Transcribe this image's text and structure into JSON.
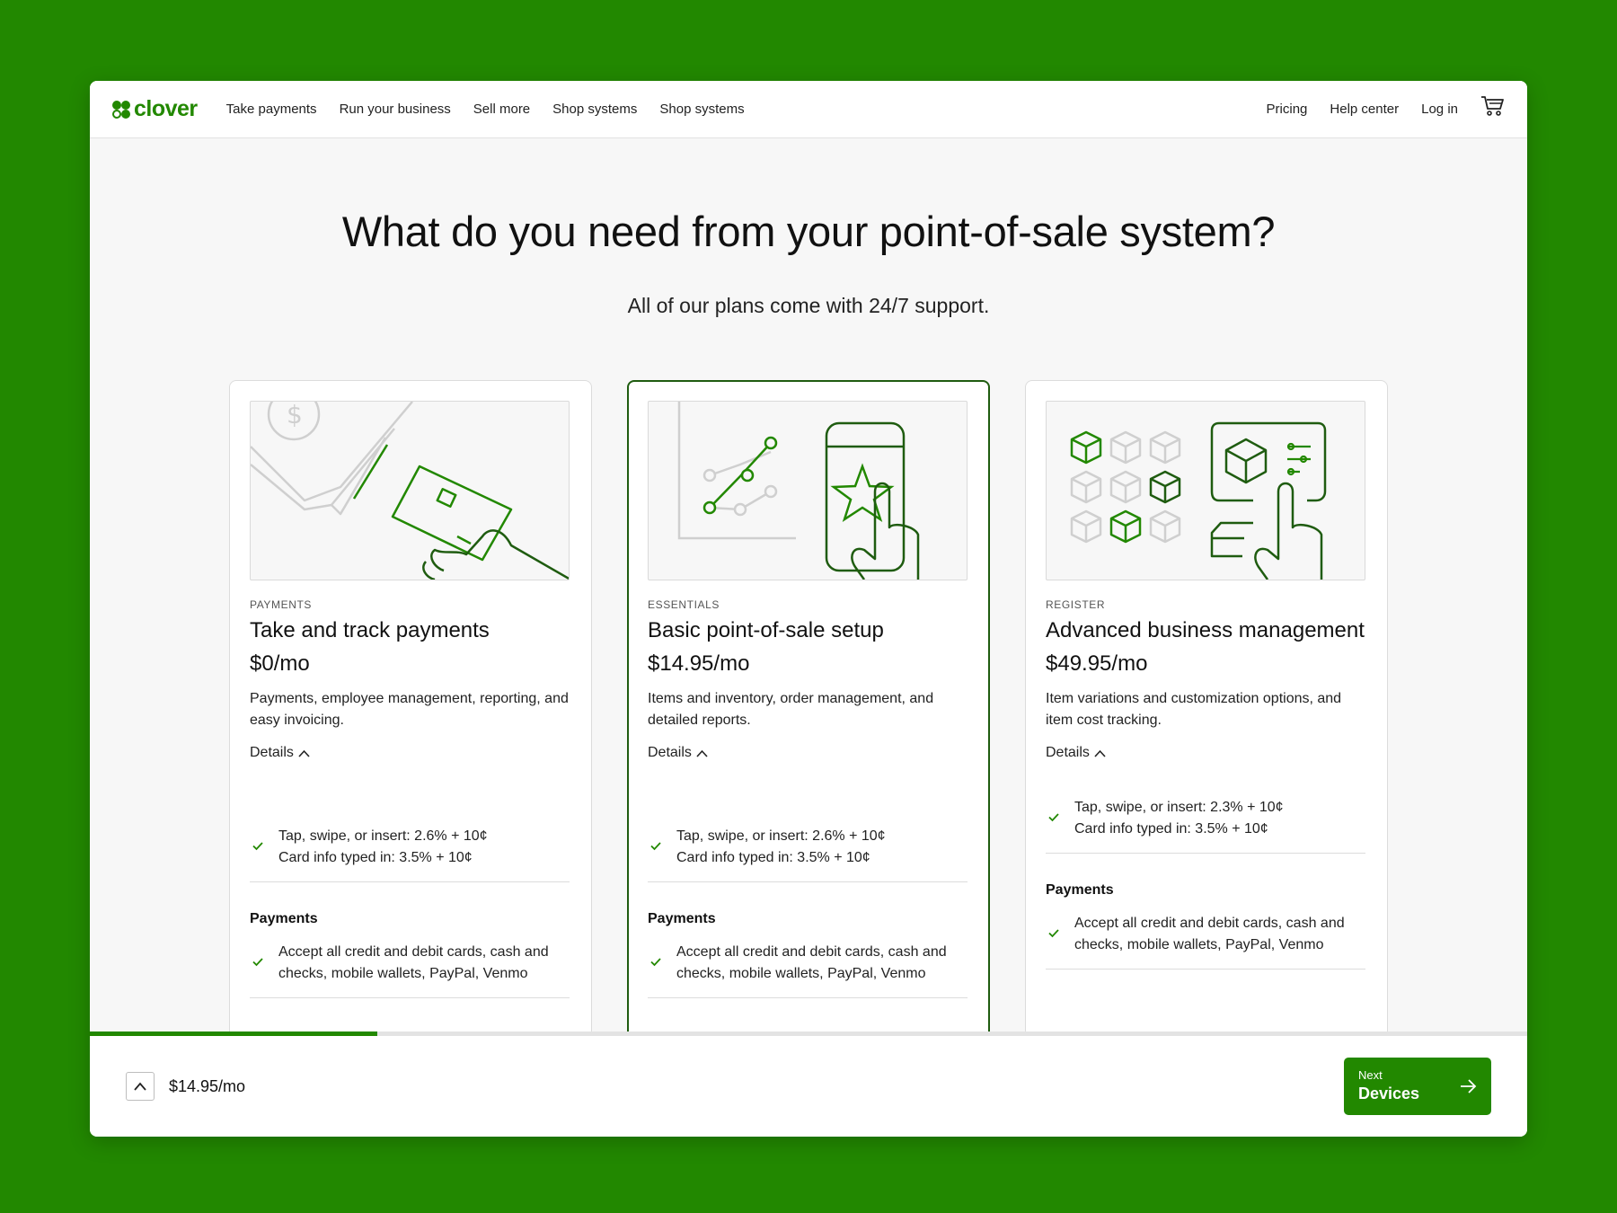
{
  "header": {
    "logo_text": "clover",
    "nav": [
      "Take payments",
      "Run your business",
      "Sell more",
      "Shop systems",
      "Shop systems"
    ],
    "nav_right": [
      "Pricing",
      "Help center",
      "Log in"
    ]
  },
  "hero": {
    "title": "What do you need from your point-of-sale system?",
    "subtitle": "All of our plans come with 24/7 support."
  },
  "plans": [
    {
      "eyebrow": "PAYMENTS",
      "title": "Take and track payments",
      "price": "$0/mo",
      "description": "Payments, employee management, reporting, and easy invoicing.",
      "details_label": "Details",
      "fees": [
        "Tap, swipe, or insert: 2.6% + 10¢",
        "Card info typed in: 3.5% + 10¢"
      ],
      "section": "Payments",
      "features": [
        "Accept all credit and debit cards, cash and checks, mobile wallets, PayPal, Venmo"
      ]
    },
    {
      "eyebrow": "ESSENTIALS",
      "title": "Basic point-of-sale setup",
      "price": "$14.95/mo",
      "description": "Items and inventory, order management, and detailed reports.",
      "details_label": "Details",
      "fees": [
        "Tap, swipe, or insert: 2.6% + 10¢",
        "Card info typed in: 3.5% + 10¢"
      ],
      "section": "Payments",
      "features": [
        "Accept all credit and debit cards, cash and checks, mobile wallets, PayPal, Venmo"
      ],
      "selected": true
    },
    {
      "eyebrow": "REGISTER",
      "title": "Advanced business management",
      "price": "$49.95/mo",
      "description": "Item variations and customization options, and item cost tracking.",
      "details_label": "Details",
      "fees": [
        "Tap, swipe, or insert: 2.3% + 10¢",
        "Card info typed in: 3.5% + 10¢"
      ],
      "section": "Payments",
      "features": [
        "Accept all credit and debit cards, cash and checks, mobile wallets, PayPal, Venmo"
      ]
    }
  ],
  "footer": {
    "selected_price": "$14.95/mo",
    "next_small": "Next",
    "next_label": "Devices",
    "progress": 0.2
  },
  "colors": {
    "brand": "#228800",
    "selected_border": "#1f5c10",
    "background": "#228800"
  },
  "icons": [
    "clover-logo-icon",
    "cart-icon",
    "chevron-up-icon",
    "check-icon",
    "arrow-right-icon"
  ]
}
